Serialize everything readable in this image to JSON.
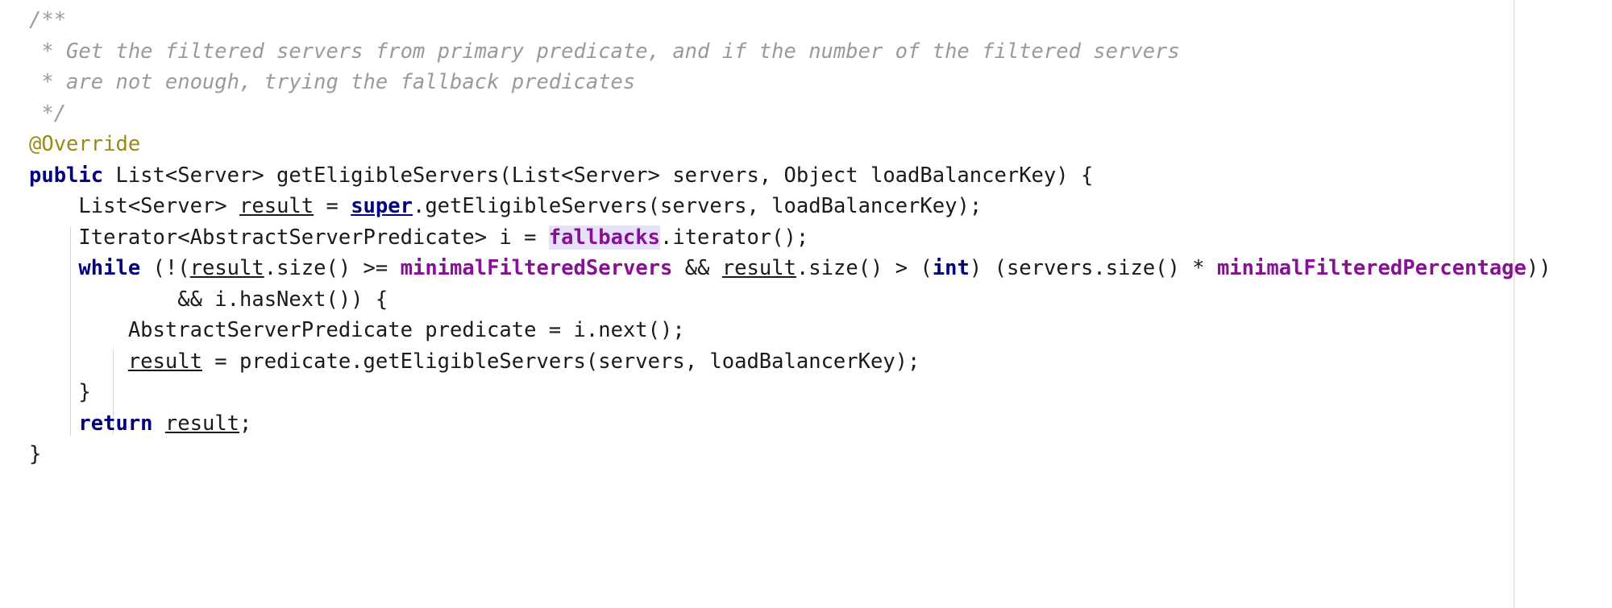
{
  "editor": {
    "language": "java",
    "font_size_px": 25.5,
    "background": "#ffffff",
    "colors": {
      "plain": "#1a1a1a",
      "comment": "#9a9a9a",
      "annotation": "#9a8a17",
      "keyword": "#000080",
      "field": "#871094",
      "highlight_background": "#e6e1f7",
      "indent_guide": "#d6d6d6",
      "margin_ruler": "#d8d8d8"
    },
    "highlighted_token": "fallbacks"
  },
  "code": {
    "line1": {
      "comment": "/**"
    },
    "line2": {
      "comment": " * Get the filtered servers from primary predicate, and if the number of the filtered servers"
    },
    "line3": {
      "comment": " * are not enough, trying the fallback predicates"
    },
    "line4": {
      "comment": " */"
    },
    "line5": {
      "annotation": "@Override"
    },
    "line6": {
      "kw": "public",
      "t1": " List<Server> getEligibleServers(List<Server> servers, Object loadBalancerKey) {"
    },
    "line7": {
      "indent": "    ",
      "t1": "List<Server> ",
      "local": "result",
      "t2": " = ",
      "kw": "super",
      "t3": ".getEligibleServers(servers, loadBalancerKey);"
    },
    "line8": {
      "indent": "    ",
      "t1": "Iterator<AbstractServerPredicate> i = ",
      "field_highlighted": "fallbacks",
      "t2": ".iterator();"
    },
    "line9": {
      "indent": "    ",
      "kw1": "while",
      "t1": " (!(",
      "local1": "result",
      "t2": ".size() >= ",
      "field1": "minimalFilteredServers",
      "t3": " && ",
      "local2": "result",
      "t4": ".size() > (",
      "kw2": "int",
      "t5": ") (servers.size() * ",
      "field2": "minimalFilteredPercentage",
      "t6": "))"
    },
    "line10": {
      "indent": "            ",
      "t1": "&& i.hasNext()) {"
    },
    "line11": {
      "indent": "        ",
      "t1": "AbstractServerPredicate predicate = i.next();"
    },
    "line12": {
      "indent": "        ",
      "local": "result",
      "t1": " = predicate.getEligibleServers(servers, loadBalancerKey);"
    },
    "line13": {
      "indent": "    ",
      "t1": "}"
    },
    "line14": {
      "indent": "    ",
      "kw": "return",
      "t1": " ",
      "local": "result",
      "t2": ";"
    },
    "line15": {
      "t1": "}"
    }
  }
}
